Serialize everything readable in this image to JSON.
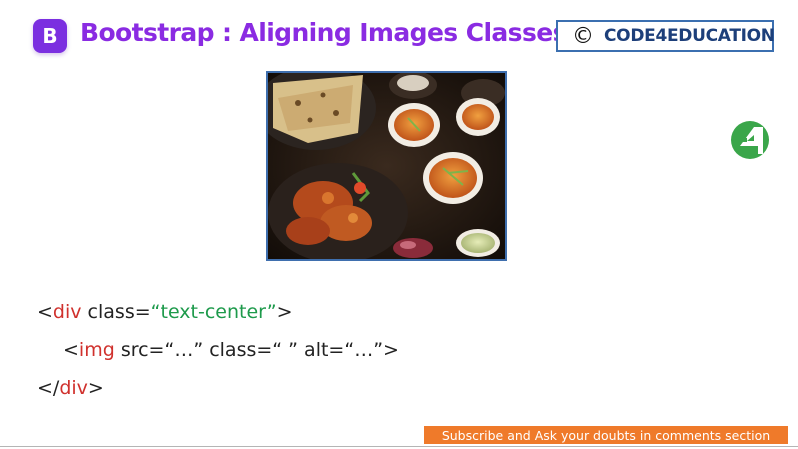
{
  "header": {
    "logo_letter": "B",
    "title": "Bootstrap : Aligning Images Classes",
    "copyright_symbol": "©",
    "copyright_text": "CODE4EDUCATION"
  },
  "code": {
    "line1": {
      "open": "<",
      "tag": "div",
      "attr": " class=",
      "value": "“text-center”",
      "close": ">"
    },
    "line2": {
      "open": "<",
      "tag": "img",
      "rest": " src=“…” class=“ ” alt=“…”>"
    },
    "line3": {
      "open": "</",
      "tag": "div",
      "close": ">"
    }
  },
  "footer": {
    "subscribe_text": "Subscribe and Ask your doubts in comments section"
  },
  "colors": {
    "title": "#8a2be2",
    "logo_bg": "#7b2fe0",
    "tag": "#d0312d",
    "string": "#1d9a4b",
    "subscribe_bg": "#ef7a2a",
    "brand_green": "#3aa64a"
  },
  "icons": {
    "logo": "bootstrap-logo-icon",
    "side_logo": "code4education-logo-icon"
  }
}
